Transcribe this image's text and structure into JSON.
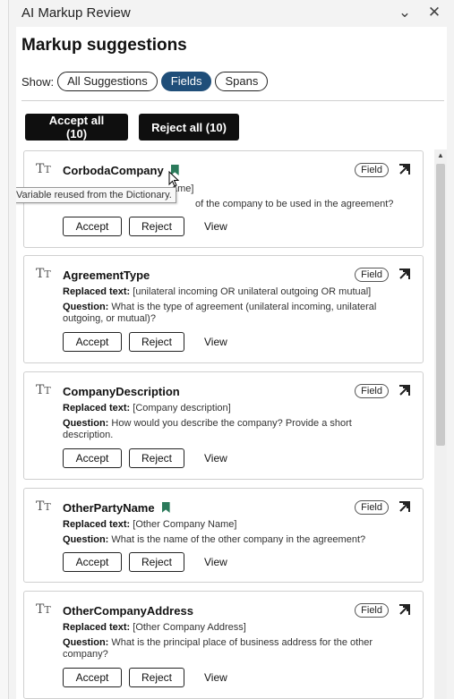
{
  "window": {
    "title": "AI Markup Review",
    "collapse_icon": "chevron-down-icon",
    "close_icon": "close-icon"
  },
  "header": {
    "heading": "Markup suggestions"
  },
  "filter": {
    "label": "Show:",
    "options": [
      "All Suggestions",
      "Fields",
      "Spans"
    ],
    "selected": "Fields"
  },
  "bulk": {
    "accept_all": "Accept all (10)",
    "reject_all": "Reject all (10)"
  },
  "tooltip": "Variable reused from the Dictionary.",
  "labels": {
    "replaced": "Replaced text:",
    "question": "Question:",
    "badge": "Field",
    "accept": "Accept",
    "reject": "Reject",
    "view": "View"
  },
  "cards": [
    {
      "name": "CorbodaCompany",
      "reused": true,
      "replaced_visible": "ame]",
      "question_visible": "of the company to be used in the agreement?"
    },
    {
      "name": "AgreementType",
      "reused": false,
      "replaced": "[unilateral incoming OR unilateral outgoing OR mutual]",
      "question": "What is the type of agreement (unilateral incoming, unilateral outgoing, or mutual)?"
    },
    {
      "name": "CompanyDescription",
      "reused": false,
      "replaced": "[Company description]",
      "question": "How would you describe the company? Provide a short description."
    },
    {
      "name": "OtherPartyName",
      "reused": true,
      "replaced": "[Other Company Name]",
      "question": "What is the name of the other company in the agreement?"
    },
    {
      "name": "OtherCompanyAddress",
      "reused": false,
      "replaced": "[Other Company Address]",
      "question": "What is the principal place of business address for the other company?"
    }
  ],
  "colors": {
    "active_pill": "#1f4e79",
    "bookmark": "#2b7a5b",
    "bulk_button": "#0f0f0f"
  }
}
